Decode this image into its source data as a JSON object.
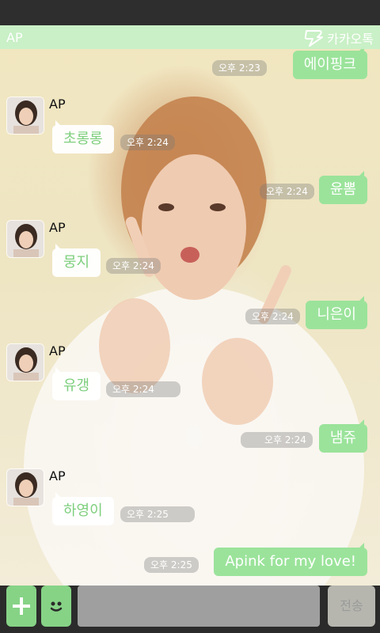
{
  "colors": {
    "accent": "#9be39b",
    "titlebar": "#c6f0c6",
    "in_text": "#7dcf7d"
  },
  "header": {
    "title": "AP",
    "brand": "카카오톡",
    "brand_icon": "kakao-bolt-icon"
  },
  "messages": [
    {
      "dir": "out",
      "text": "에이핑크",
      "time": "오후 2:23"
    },
    {
      "dir": "in",
      "sender": "AP",
      "text": "초롱롱",
      "time": "오후 2:24"
    },
    {
      "dir": "out",
      "text": "윤뽐",
      "time": "오후 2:24"
    },
    {
      "dir": "in",
      "sender": "AP",
      "text": "뭉지",
      "time": "오후 2:24"
    },
    {
      "dir": "out",
      "text": "니은이",
      "time": "오후 2:24"
    },
    {
      "dir": "in",
      "sender": "AP",
      "text": "유갱",
      "time": "오후 2:24"
    },
    {
      "dir": "out",
      "text": "냄쥬",
      "time": "오후 2:24"
    },
    {
      "dir": "in",
      "sender": "AP",
      "text": "하영이",
      "time": "오후 2:25"
    },
    {
      "dir": "out",
      "text": "Apink for my love!",
      "time": "오후 2:25"
    }
  ],
  "composer": {
    "value": "",
    "send_label": "전송",
    "plus_icon": "plus-icon",
    "emoji_icon": "smiley-icon"
  }
}
